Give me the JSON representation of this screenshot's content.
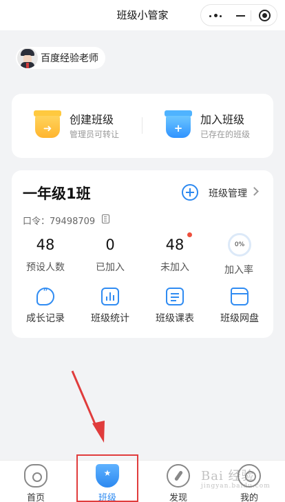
{
  "app": {
    "title": "班级小管家"
  },
  "user": {
    "name": "百度经验老师"
  },
  "actions": [
    {
      "name": "创建班级",
      "sub": "管理员可转让",
      "color_top": "#ffd35c",
      "color_bottom": "#ffb52e",
      "icon": "arrow-right-icon"
    },
    {
      "name": "加入班级",
      "sub": "已存在的班级",
      "color_top": "#6cc6ff",
      "color_bottom": "#2f93ff",
      "icon": "plus-icon"
    }
  ],
  "klass": {
    "name": "一年级1班",
    "manage_label": "班级管理",
    "code_text": "口令：79498709",
    "stats": [
      {
        "num": "48",
        "label": "预设人数"
      },
      {
        "num": "0",
        "label": "已加入"
      },
      {
        "num": "48",
        "label": "未加入"
      }
    ],
    "rate_value": "0%",
    "rate_label": "加入率",
    "tools": [
      {
        "label": "成长记录",
        "icon": "chat-bubble-icon"
      },
      {
        "label": "班级统计",
        "icon": "bar-chart-icon"
      },
      {
        "label": "班级课表",
        "icon": "schedule-icon"
      },
      {
        "label": "班级网盘",
        "icon": "folder-icon"
      }
    ]
  },
  "tabbar": [
    {
      "label": "首页",
      "icon": "home-icon",
      "active": false
    },
    {
      "label": "班级",
      "icon": "class-icon",
      "active": true
    },
    {
      "label": "发现",
      "icon": "explore-icon",
      "active": false
    },
    {
      "label": "我的",
      "icon": "profile-icon",
      "active": false
    }
  ],
  "watermark": {
    "text": "Bai 经验",
    "sub": "jingyan.baidu.com"
  },
  "colors": {
    "accent": "#2b88f0",
    "annotation_red": "#e03c3c",
    "background": "#f2f3f5"
  }
}
